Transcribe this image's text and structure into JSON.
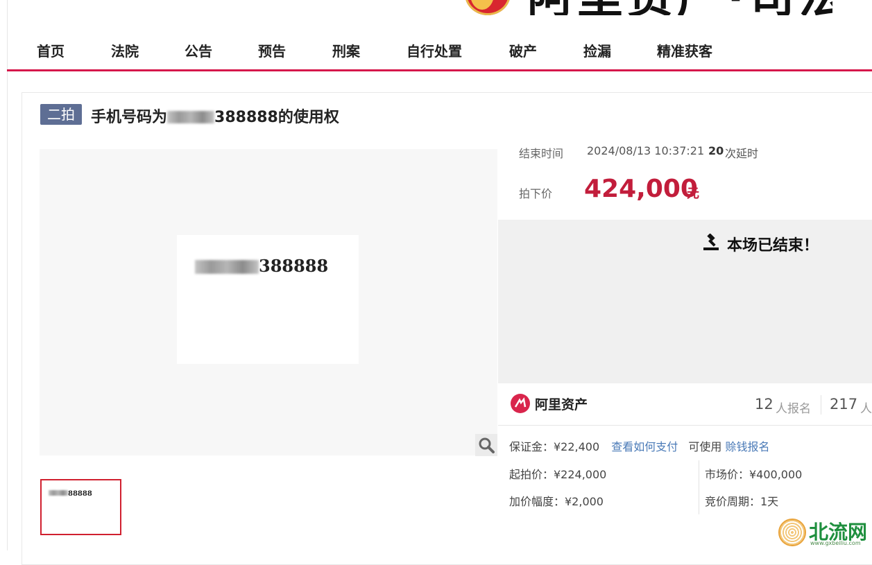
{
  "header": {
    "logo_text": "阿里资产·司法"
  },
  "nav": {
    "items": [
      "首页",
      "法院",
      "公告",
      "预告",
      "刑案",
      "自行处置",
      "破产",
      "捡漏",
      "精准获客"
    ]
  },
  "item": {
    "round_badge": "二拍",
    "title_prefix": "手机号码为",
    "title_suffix": "388888的使用权",
    "image_number_suffix": "388888",
    "thumb_number_suffix": "88888"
  },
  "auction": {
    "end_time_label": "结束时间",
    "end_time": "2024/08/13 10:37:21",
    "extension_count": "20",
    "extension_label": "次延时",
    "final_price_label": "拍下价",
    "final_price": "424,000",
    "price_unit": "元",
    "status": "本场已结束！"
  },
  "platform": {
    "name": "阿里资产",
    "signup_count": "12",
    "signup_label": "人报名",
    "watch_count": "217",
    "watch_label": "人"
  },
  "details": {
    "deposit": "保证金：¥22,400",
    "pay_link": "查看如何支付",
    "usable_label": "可使用",
    "earn_link": "赊钱报名",
    "start_price": "起拍价：¥224,000",
    "market_price": "市场价：¥400,000",
    "increment": "加价幅度：¥2,000",
    "cycle": "竞价周期：1天"
  },
  "watermark": {
    "text": "北流网",
    "url": "www.gxbeiliu.com"
  },
  "colors": {
    "accent": "#d6174a",
    "price": "#c21d3b",
    "badge": "#5e6e94",
    "link": "#4a7ab7"
  }
}
